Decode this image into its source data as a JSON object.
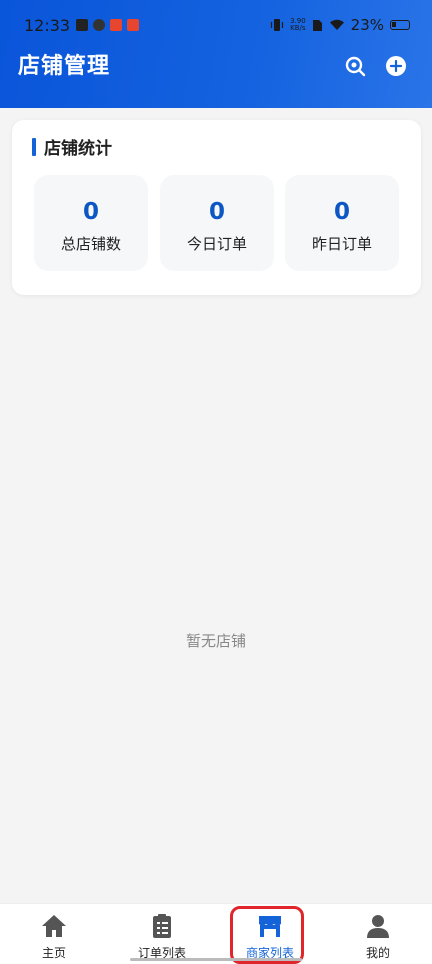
{
  "status_bar": {
    "time": "12:33",
    "net_speed_value": "3.90",
    "net_speed_unit": "KB/s",
    "battery": "23%"
  },
  "header": {
    "title": "店铺管理",
    "search_icon": "search-icon",
    "add_icon": "plus-circle-icon"
  },
  "stats": {
    "title": "店铺统计",
    "items": [
      {
        "value": "0",
        "label": "总店铺数"
      },
      {
        "value": "0",
        "label": "今日订单"
      },
      {
        "value": "0",
        "label": "昨日订单"
      }
    ]
  },
  "empty_message": "暂无店铺",
  "tabbar": {
    "active_index": 2,
    "items": [
      {
        "label": "主页",
        "icon": "home-icon"
      },
      {
        "label": "订单列表",
        "icon": "clipboard-icon"
      },
      {
        "label": "商家列表",
        "icon": "store-icon"
      },
      {
        "label": "我的",
        "icon": "user-icon"
      }
    ]
  },
  "colors": {
    "primary": "#1463d8",
    "header_gradient_start": "#0a55d9",
    "header_gradient_end": "#2a74e8",
    "highlight": "#e0262b"
  }
}
